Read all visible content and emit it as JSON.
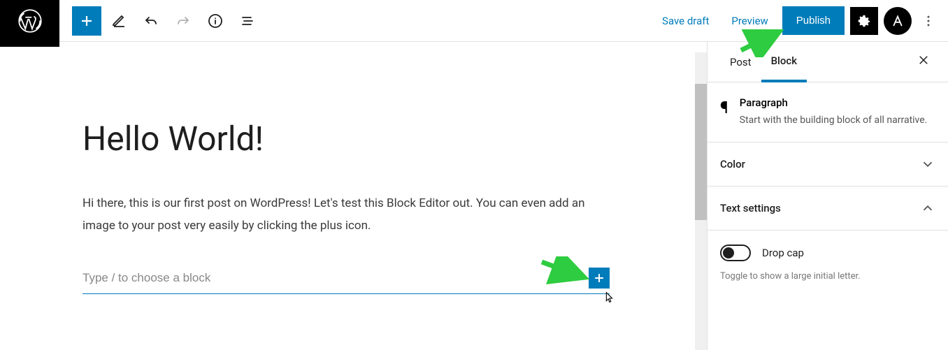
{
  "toolbar": {
    "save_draft": "Save draft",
    "preview": "Preview",
    "publish": "Publish"
  },
  "editor": {
    "title": "Hello World!",
    "paragraph": "Hi there, this is our first post on WordPress! Let's test this Block Editor out. You can even add an image to your post very easily by clicking the plus icon.",
    "block_placeholder": "Type / to choose a block"
  },
  "sidebar": {
    "tabs": {
      "post": "Post",
      "block": "Block"
    },
    "block_type": {
      "name": "Paragraph",
      "description": "Start with the building block of all narrative."
    },
    "sections": {
      "color": "Color",
      "text_settings": "Text settings"
    },
    "drop_cap": {
      "label": "Drop cap",
      "help": "Toggle to show a large initial letter."
    }
  },
  "colors": {
    "primary": "#007cba",
    "arrow": "#2ecc40"
  }
}
